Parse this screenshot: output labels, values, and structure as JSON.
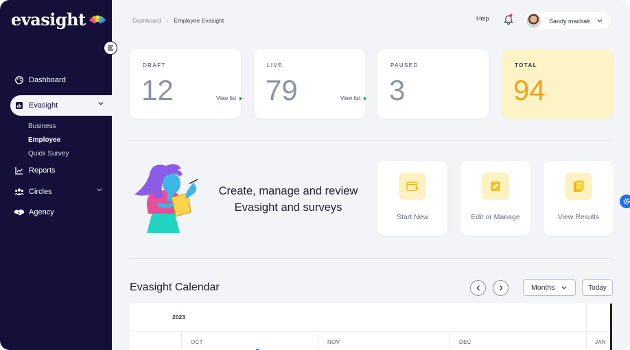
{
  "app": {
    "logo_text": "evasight"
  },
  "sidebar": {
    "items": [
      {
        "label": "Dashboard",
        "icon": "palette-icon"
      },
      {
        "label": "Evasight",
        "icon": "bar-chart-icon",
        "active": true
      },
      {
        "label": "Reports",
        "icon": "line-chart-icon"
      },
      {
        "label": "Circles",
        "icon": "people-icon"
      },
      {
        "label": "Agency",
        "icon": "handshake-icon"
      }
    ],
    "sub_items": [
      {
        "label": "Business"
      },
      {
        "label": "Employee",
        "current": true
      },
      {
        "label": "Quick Survey"
      }
    ]
  },
  "header": {
    "breadcrumb": [
      "Dashboard",
      "Employee Evasight"
    ],
    "help": "Help",
    "user_name": "Sandy maclrak"
  },
  "stats": [
    {
      "label": "DRAFT",
      "value": "12",
      "link": "View list"
    },
    {
      "label": "LIVE",
      "value": "79",
      "link": "View list"
    },
    {
      "label": "PAUSED",
      "value": "3"
    },
    {
      "label": "TOTAL",
      "value": "94"
    }
  ],
  "banner": {
    "line1": "Create, manage and review",
    "line2": "Evasight and surveys"
  },
  "actions": [
    {
      "label": "Start New",
      "icon": "calendar-add-icon"
    },
    {
      "label": "Edit or Manage",
      "icon": "edit-icon"
    },
    {
      "label": "View Results",
      "icon": "document-list-icon"
    }
  ],
  "calendar": {
    "title": "Evasight Calendar",
    "view_label": "Months",
    "today_label": "Today",
    "year": "2023",
    "months": [
      "OCT",
      "NOV",
      "DEC",
      "JAN"
    ]
  },
  "colors": {
    "sidebar_bg": "#15103a",
    "accent_yellow": "#fcf4c7",
    "total_number": "#f0a21b",
    "link_arrow": "#1f8a3a",
    "help_widget": "#1e6ff0"
  }
}
